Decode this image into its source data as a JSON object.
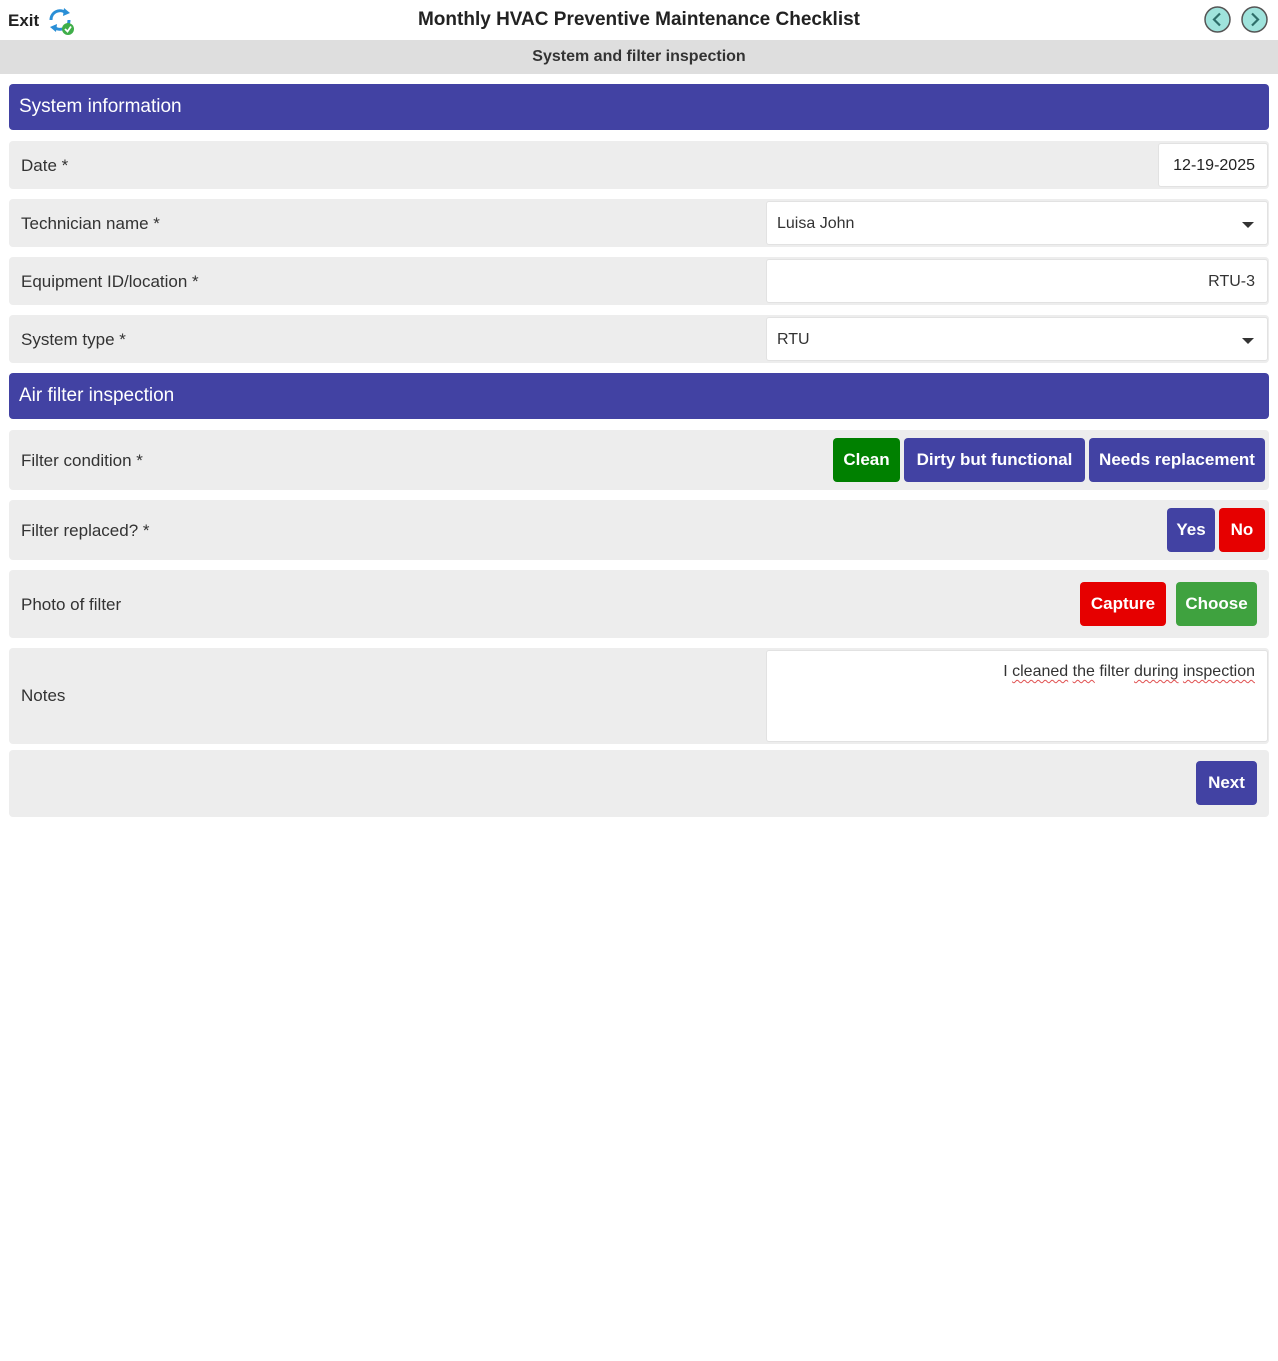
{
  "header": {
    "exit_label": "Exit",
    "title": "Monthly HVAC Preventive Maintenance Checklist",
    "subtitle": "System and filter inspection",
    "sync_icon": "sync-status-icon",
    "prev_icon": "arrow-left-circle-icon",
    "next_icon": "arrow-right-circle-icon"
  },
  "sections": {
    "system_info": {
      "title": "System information",
      "date": {
        "label": "Date *",
        "value": "12-19-2025"
      },
      "technician": {
        "label": "Technician name *",
        "value": "Luisa John"
      },
      "equipment": {
        "label": "Equipment ID/location *",
        "value": "RTU-3"
      },
      "system_type": {
        "label": "System type *",
        "value": "RTU"
      }
    },
    "air_filter": {
      "title": "Air filter inspection",
      "filter_condition": {
        "label": "Filter condition *",
        "options": [
          "Clean",
          "Dirty but functional",
          "Needs replacement"
        ],
        "selected": "Clean"
      },
      "filter_replaced": {
        "label": "Filter replaced? *",
        "options": [
          "Yes",
          "No"
        ],
        "selected": "No"
      },
      "photo": {
        "label": "Photo of filter",
        "capture_label": "Capture",
        "choose_label": "Choose"
      },
      "notes": {
        "label": "Notes",
        "words": [
          "I",
          "cleaned",
          "the",
          "filter",
          "during",
          "inspection"
        ]
      }
    }
  },
  "footer": {
    "next_label": "Next"
  },
  "colors": {
    "header_purple": "#4242a3",
    "selected_green": "#008000",
    "selected_red": "#e60000",
    "capture_red": "#e60000",
    "choose_green": "#3fa23f",
    "row_bg": "#ededed",
    "subbar_bg": "#dedede"
  }
}
